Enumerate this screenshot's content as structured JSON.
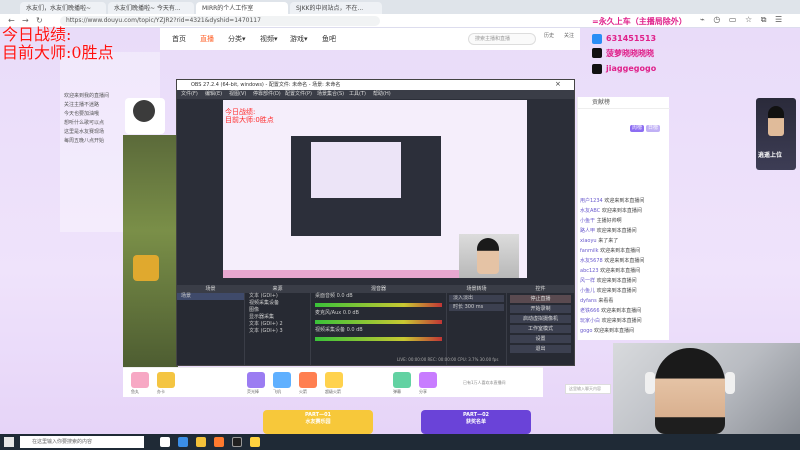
{
  "browser": {
    "tabs": [
      "水友们，水友们晚播啦~",
      "水友们晚播啦~ 今天有...",
      "MIRR的个人工作室",
      "SJKK的中间站点，不在..."
    ],
    "url": "https://www.douyu.com/topic/YZJR2?rid=4321&dyshid=1470117"
  },
  "douyu_nav": {
    "items": [
      "首页",
      "直播",
      "分类▾",
      "视频▾",
      "游戏▾",
      "鱼吧"
    ],
    "search_placeholder": "搜索主播和直播",
    "icons_labels": [
      "历史",
      "关注",
      "下载",
      "消息"
    ]
  },
  "overlay": {
    "line1": "今日战绩:",
    "line2": "目前大师:0胜点",
    "small_line1": "今日战绩:",
    "small_line2": "目前大师:0胜点"
  },
  "left_panel": {
    "lines": [
      "欢迎来到我的直播间",
      "关注主播不迷路",
      "今天也要加油哦",
      "想听什么歌可以点",
      "这里是水友赛现场",
      "每周五晚八点开始"
    ]
  },
  "obs": {
    "title": "OBS 27.2.4 (64-bit, windows) - 配置文件: 未命名 - 场景: 未命名",
    "menu": [
      "文件(F)",
      "编辑(E)",
      "视图(V)",
      "停靠部件(D)",
      "配置文件(P)",
      "场景集合(S)",
      "工具(T)",
      "帮助(H)"
    ],
    "preview_text": "看看能不能",
    "docks": {
      "scenes": {
        "title": "场景",
        "items": [
          "场景"
        ]
      },
      "sources": {
        "title": "来源",
        "items": [
          "文本 (GDI+)",
          "视频采集设备",
          "图像",
          "显示器采集",
          "文本 (GDI+) 2",
          "文本 (GDI+) 3"
        ]
      },
      "mixer": {
        "title": "混音器",
        "items": [
          "桌面音频  0.0 dB",
          "麦克风/Aux  0.0 dB",
          "视频采集设备  0.0 dB"
        ]
      },
      "transitions": {
        "title": "场景转场",
        "items": [
          "淡入淡出",
          "时长  300 ms"
        ]
      },
      "controls": {
        "title": "控件",
        "buttons": [
          "停止直播",
          "开始录制",
          "启动虚拟摄像机",
          "工作室模式",
          "设置",
          "退出"
        ]
      }
    },
    "status": "LIVE: 00:00:00   REC: 00:00:00   CPU: 3.7%   30.00 fps"
  },
  "top_right": {
    "slogan": "=永久上车（主播局除外）",
    "qq": "631451513",
    "douyin1": "菠萝晓晓晓晓",
    "douyin2": "jiaggegogo",
    "window_icons": "⌁ ◷ ▭ ☆ ⧉ ☰"
  },
  "chat": {
    "header": "贡献榜",
    "tabs": [
      "周榜",
      "日榜",
      "贵宾"
    ],
    "messages": [
      {
        "user": "用户1234",
        "text": " 欢迎来到本直播间"
      },
      {
        "user": "水友ABC",
        "text": " 欢迎来到本直播间"
      },
      {
        "user": "小鱼干",
        "text": " 主播好帅啊"
      },
      {
        "user": "路人甲",
        "text": " 欢迎来到本直播间"
      },
      {
        "user": "xiaoyu",
        "text": " 来了来了"
      },
      {
        "user": "fanmilk",
        "text": " 欢迎来到本直播间"
      },
      {
        "user": "水友5678",
        "text": " 欢迎来到本直播间"
      },
      {
        "user": "abc123",
        "text": " 欢迎来到本直播间"
      },
      {
        "user": "风一样",
        "text": " 欢迎来到本直播间"
      },
      {
        "user": "小鱼儿",
        "text": " 欢迎来到本直播间"
      },
      {
        "user": "dyfans",
        "text": " 来看看"
      },
      {
        "user": "老铁666",
        "text": " 欢迎来到本直播间"
      },
      {
        "user": "玩家小白",
        "text": " 欢迎来到本直播间"
      },
      {
        "user": "gogo",
        "text": " 欢迎来到本直播间"
      }
    ],
    "input_placeholder": "这里输入聊天内容"
  },
  "gift_bar": {
    "labels": [
      "鱼丸",
      "办卡",
      "荧光棒",
      "飞机",
      "火箭",
      "超级火箭",
      "弹幕",
      "分享"
    ],
    "note": "已有1万人喜欢本直播间",
    "colors": [
      "#f7a8c4",
      "#f4c542",
      "#9b7cf2",
      "#5fb0ff",
      "#ff7f50",
      "#ffd24d",
      "#62d2a2",
      "#c87cff"
    ]
  },
  "banners": {
    "part1": "PART—01\n水友赛乐园",
    "part2": "PART—02\n获奖名单"
  },
  "promo": {
    "text": "逍遥上位"
  },
  "taskbar": {
    "search_placeholder": "在这里输入你要搜索的内容",
    "time": "20:15",
    "date": "2022/3/18"
  }
}
